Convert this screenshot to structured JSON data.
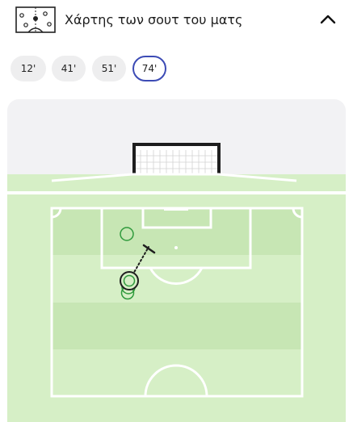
{
  "header": {
    "title": "Χάρτης των σουτ του ματς",
    "icon": "pitch-diagram-icon",
    "collapse_icon": "chevron-up-icon"
  },
  "minute_filters": [
    {
      "label": "12'",
      "selected": false
    },
    {
      "label": "41'",
      "selected": false
    },
    {
      "label": "51'",
      "selected": false
    },
    {
      "label": "74'",
      "selected": true
    }
  ],
  "colors": {
    "accent": "#3c4bb5",
    "pitch_light": "#d6efc6",
    "pitch_dark": "#c7e6b4",
    "shot_marker": "#2f9a3c",
    "card_background": "#f2f2f4"
  }
}
